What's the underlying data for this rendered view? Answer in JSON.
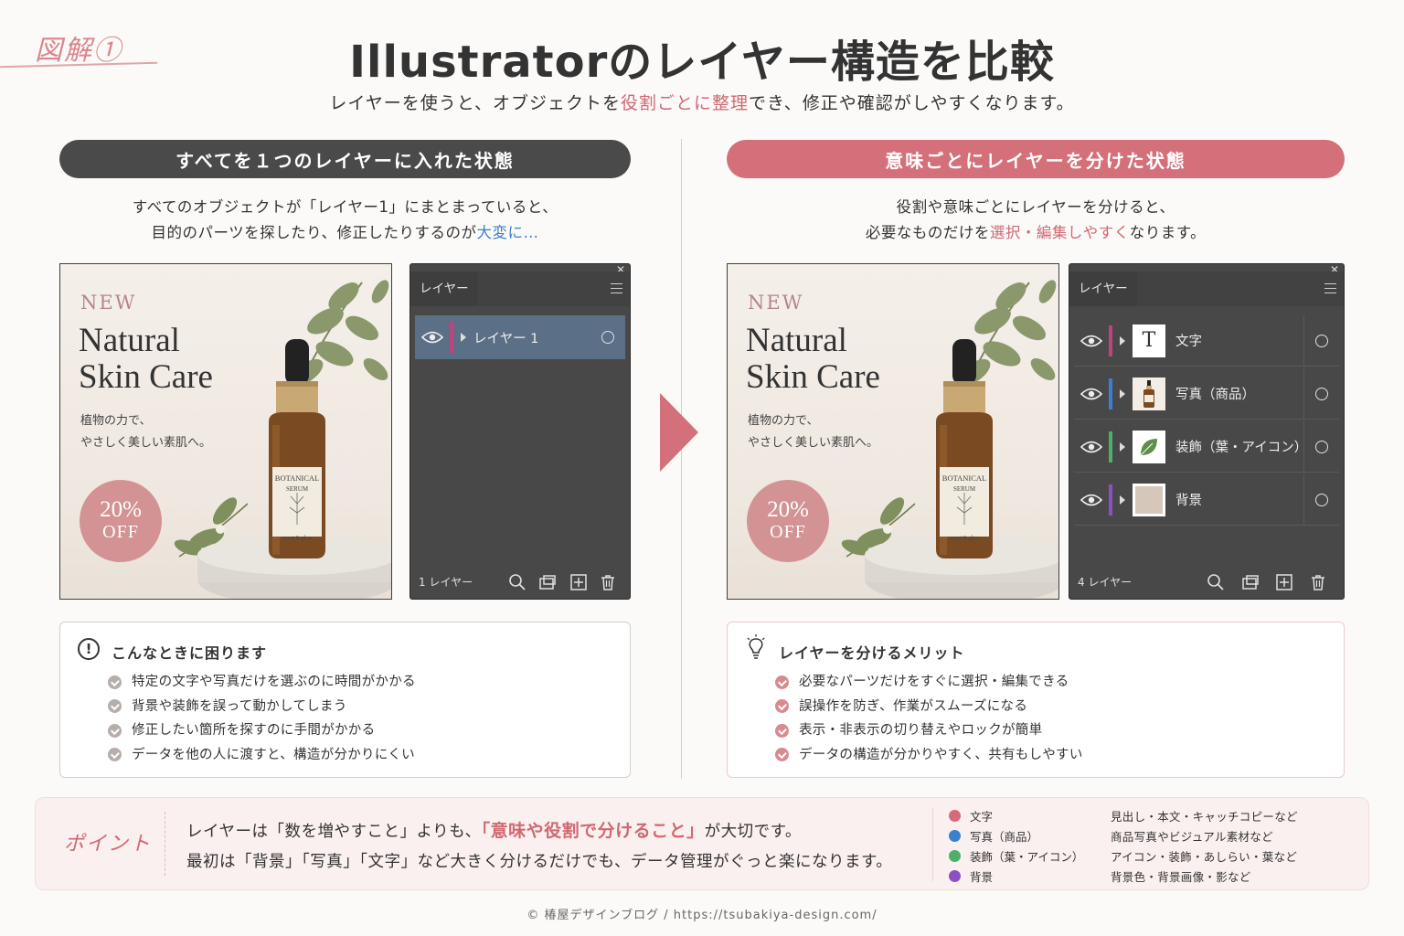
{
  "header": {
    "figure_tag": "図解①",
    "title": "Illustratorのレイヤー構造を比較",
    "subtitle_pre": "レイヤーを使うと、オブジェクトを",
    "subtitle_accent": "役割ごとに整理",
    "subtitle_post": "でき、修正や確認がしやすくなります。"
  },
  "left": {
    "pill": "すべてを１つのレイヤーに入れた状態",
    "desc_line1": "すべてのオブジェクトが「レイヤー1」にまとまっていると、",
    "desc_line2_pre": "目的のパーツを探したり、修正したりするのが",
    "desc_line2_accent": "大変に…",
    "panel": {
      "tab": "レイヤー",
      "close": "✕",
      "layer_name": "レイヤー 1",
      "footer": "1 レイヤー"
    },
    "box": {
      "title": "こんなときに困ります",
      "icon": "!",
      "items": [
        "特定の文字や写真だけを選ぶのに時間がかかる",
        "背景や装飾を誤って動かしてしまう",
        "修正したい箇所を探すのに手間がかかる",
        "データを他の人に渡すと、構造が分かりにくい"
      ]
    }
  },
  "right": {
    "pill": "意味ごとにレイヤーを分けた状態",
    "desc_line1": "役割や意味ごとにレイヤーを分けると、",
    "desc_line2_pre": "必要なものだけを",
    "desc_line2_accent": "選択・編集しやすく",
    "desc_line2_post": "なります。",
    "panel": {
      "tab": "レイヤー",
      "close": "✕",
      "footer": "4 レイヤー",
      "layers": [
        {
          "name": "文字",
          "color": "#c0427e",
          "thumb": "T"
        },
        {
          "name": "写真（商品）",
          "color": "#3b7fd2",
          "thumb": ""
        },
        {
          "name": "装飾（葉・アイコン）",
          "color": "#4caf6a",
          "thumb": ""
        },
        {
          "name": "背景",
          "color": "#8d4fc4",
          "thumb": ""
        }
      ]
    },
    "box": {
      "title": "レイヤーを分けるメリット",
      "items": [
        "必要なパーツだけをすぐに選択・編集できる",
        "誤操作を防ぎ、作業がスムーズになる",
        "表示・非表示の切り替えやロックが簡単",
        "データの構造が分かりやすく、共有もしやすい"
      ]
    }
  },
  "ad": {
    "new": "NEW",
    "headline": "Natural\nSkin Care",
    "tagline": "植物の力で、\nやさしく美しい素肌へ。",
    "badge_pct": "20%",
    "badge_off": "OFF",
    "bottle_label1": "BOTANICAL",
    "bottle_label2": "SERUM",
    "bottle_label3": "sweet & glow"
  },
  "point": {
    "label": "ポイント",
    "line1_pre": "レイヤーは「数を増やすこと」よりも、",
    "line1_accent": "「意味や役割で分けること」",
    "line1_post": "が大切です。",
    "line2": "最初は「背景」「写真」「文字」など大きく分けるだけでも、データ管理がぐっと楽になります。"
  },
  "legend": [
    {
      "name": "文字",
      "color": "#d46a7a",
      "desc": "見出し・本文・キャッチコピーなど"
    },
    {
      "name": "写真（商品）",
      "color": "#3b7fd2",
      "desc": "商品写真やビジュアル素材など"
    },
    {
      "name": "装飾（葉・アイコン）",
      "color": "#4caf6a",
      "desc": "アイコン・装飾・あしらい・葉など"
    },
    {
      "name": "背景",
      "color": "#8d4fc4",
      "desc": "背景色・背景画像・影など"
    }
  ],
  "credit": "© 椿屋デザインブログ / https://tsubakiya-design.com/"
}
